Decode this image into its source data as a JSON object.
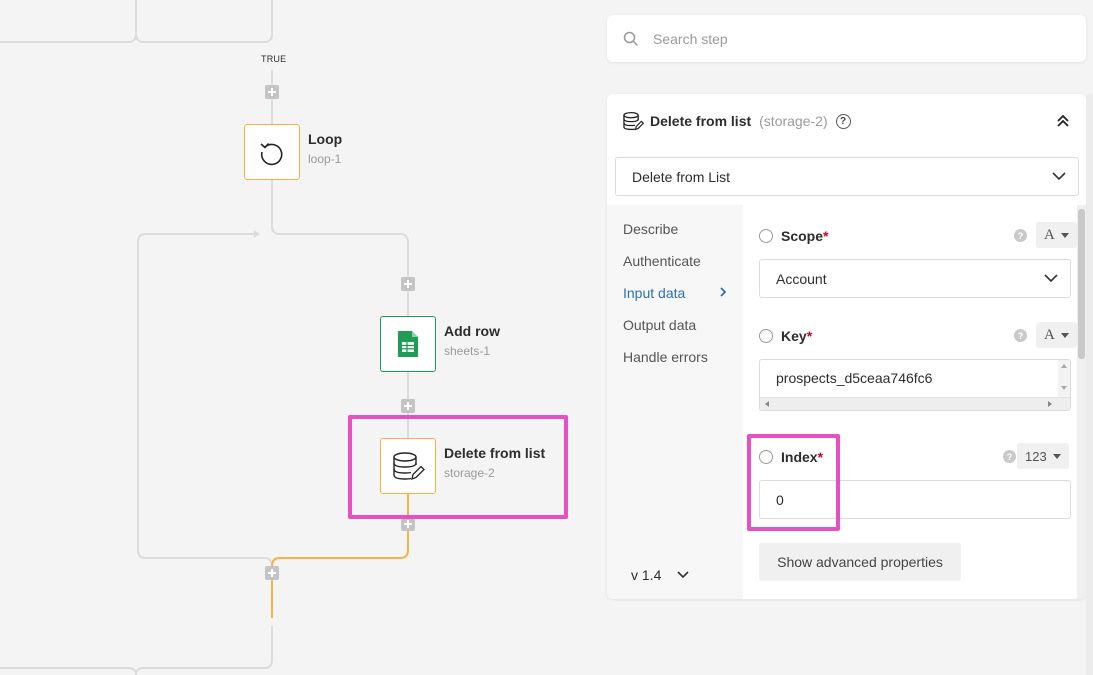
{
  "canvas": {
    "branch_label": "TRUE",
    "nodes": [
      {
        "title": "Loop",
        "id": "loop-1"
      },
      {
        "title": "Add row",
        "id": "sheets-1"
      },
      {
        "title": "Delete from list",
        "id": "storage-2"
      }
    ]
  },
  "search": {
    "placeholder": "Search step"
  },
  "panel": {
    "title": "Delete from list",
    "step_id": "(storage-2)",
    "help_glyph": "?",
    "operation": "Delete from List",
    "tabs": [
      {
        "label": "Describe"
      },
      {
        "label": "Authenticate"
      },
      {
        "label": "Input data"
      },
      {
        "label": "Output data"
      },
      {
        "label": "Handle errors"
      }
    ],
    "active_tab": "Input data",
    "version": "v 1.4",
    "fields": {
      "scope": {
        "label": "Scope",
        "required_mark": "*",
        "type": "A",
        "value": "Account"
      },
      "key": {
        "label": "Key",
        "required_mark": "*",
        "type": "A",
        "value": "prospects_d5ceaa746fc6"
      },
      "index": {
        "label": "Index",
        "required_mark": "*",
        "type": "123",
        "value": "0"
      }
    },
    "help_hint": "?",
    "advanced_button": "Show advanced properties"
  },
  "colors": {
    "accent_blue": "#2b6fb7",
    "node_orange": "#f5b342",
    "sheets_green": "#1f9d55",
    "highlight_pink": "#e84fc0",
    "required_red": "#d0021b"
  }
}
